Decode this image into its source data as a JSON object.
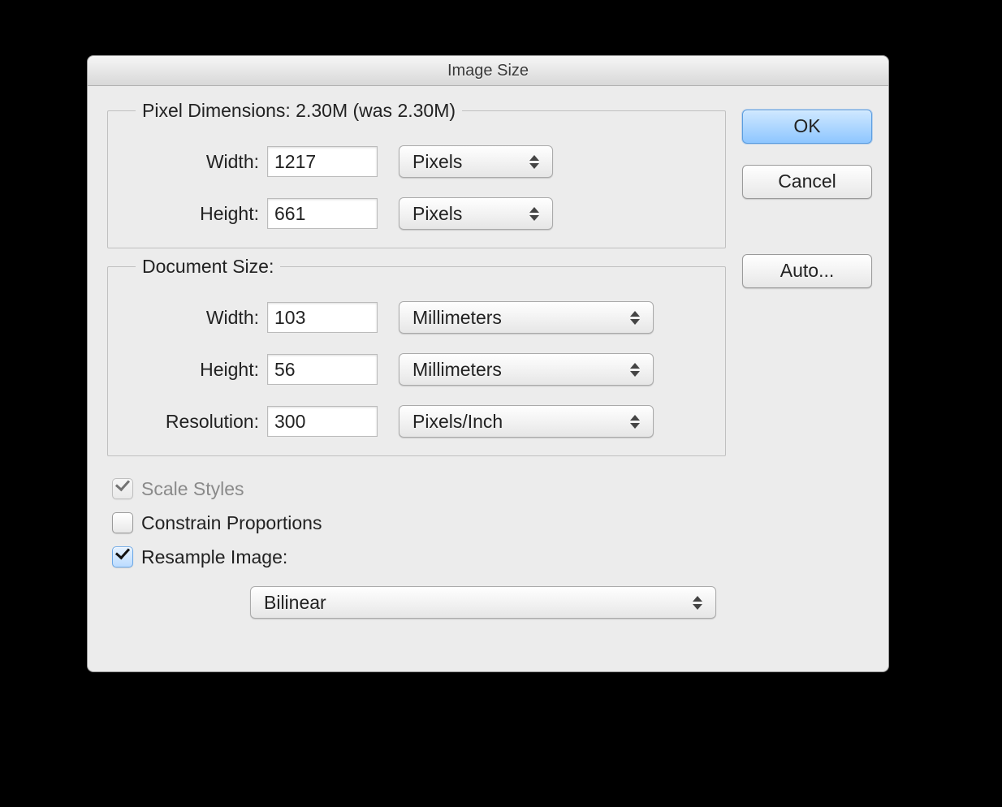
{
  "window": {
    "title": "Image Size"
  },
  "buttons": {
    "ok": "OK",
    "cancel": "Cancel",
    "auto": "Auto..."
  },
  "pixelDimensions": {
    "legend": "Pixel Dimensions:  2.30M (was 2.30M)",
    "width_label": "Width:",
    "width_value": "1217",
    "width_unit": "Pixels",
    "height_label": "Height:",
    "height_value": "661",
    "height_unit": "Pixels"
  },
  "documentSize": {
    "legend": "Document Size:",
    "width_label": "Width:",
    "width_value": "103",
    "width_unit": "Millimeters",
    "height_label": "Height:",
    "height_value": "56",
    "height_unit": "Millimeters",
    "resolution_label": "Resolution:",
    "resolution_value": "300",
    "resolution_unit": "Pixels/Inch"
  },
  "options": {
    "scale_styles": "Scale Styles",
    "constrain": "Constrain Proportions",
    "resample": "Resample Image:",
    "resample_method": "Bilinear"
  }
}
